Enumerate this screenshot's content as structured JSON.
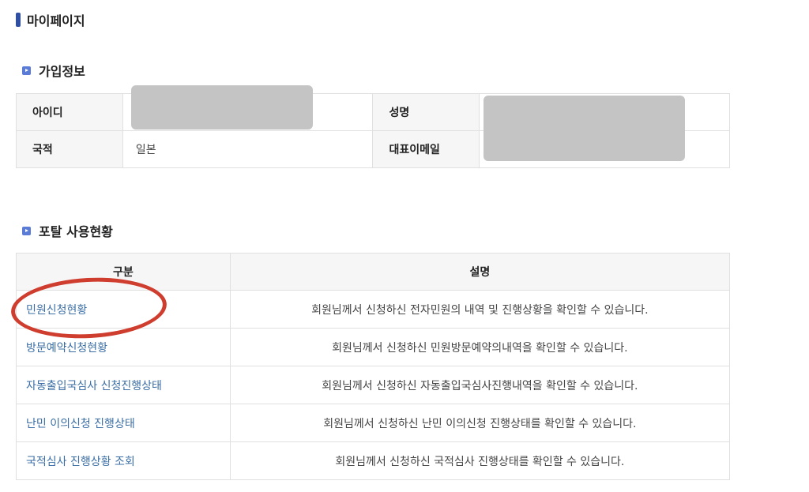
{
  "page": {
    "title": "마이페이지"
  },
  "signup_info": {
    "heading": "가입정보",
    "rows": [
      {
        "label_left": "아이디",
        "value_left": "",
        "label_right": "성명",
        "value_right": ""
      },
      {
        "label_left": "국적",
        "value_left": "일본",
        "label_right": "대표이메일",
        "value_right": ""
      }
    ]
  },
  "portal_usage": {
    "heading": "포탈 사용현황",
    "columns": [
      "구분",
      "설명"
    ],
    "rows": [
      {
        "category": "민원신청현황",
        "description": "회원님께서 신청하신 전자민원의 내역 및 진행상황을 확인할 수 있습니다."
      },
      {
        "category": "방문예약신청현황",
        "description": "회원님께서 신청하신 민원방문예약의내역을 확인할 수 있습니다."
      },
      {
        "category": "자동출입국심사 신청진행상태",
        "description": "회원님께서 신청하신 자동출입국심사진행내역을 확인할 수 있습니다."
      },
      {
        "category": "난민 이의신청 진행상태",
        "description": "회원님께서 신청하신 난민 이의신청 진행상태를 확인할 수 있습니다."
      },
      {
        "category": "국적심사 진행상황 조회",
        "description": "회원님께서 신청하신 국적심사 진행상태를 확인할 수 있습니다."
      }
    ]
  },
  "colors": {
    "title_bar": "#2f4fa3",
    "link": "#3a6ea5",
    "highlight": "#cf3d2e"
  }
}
